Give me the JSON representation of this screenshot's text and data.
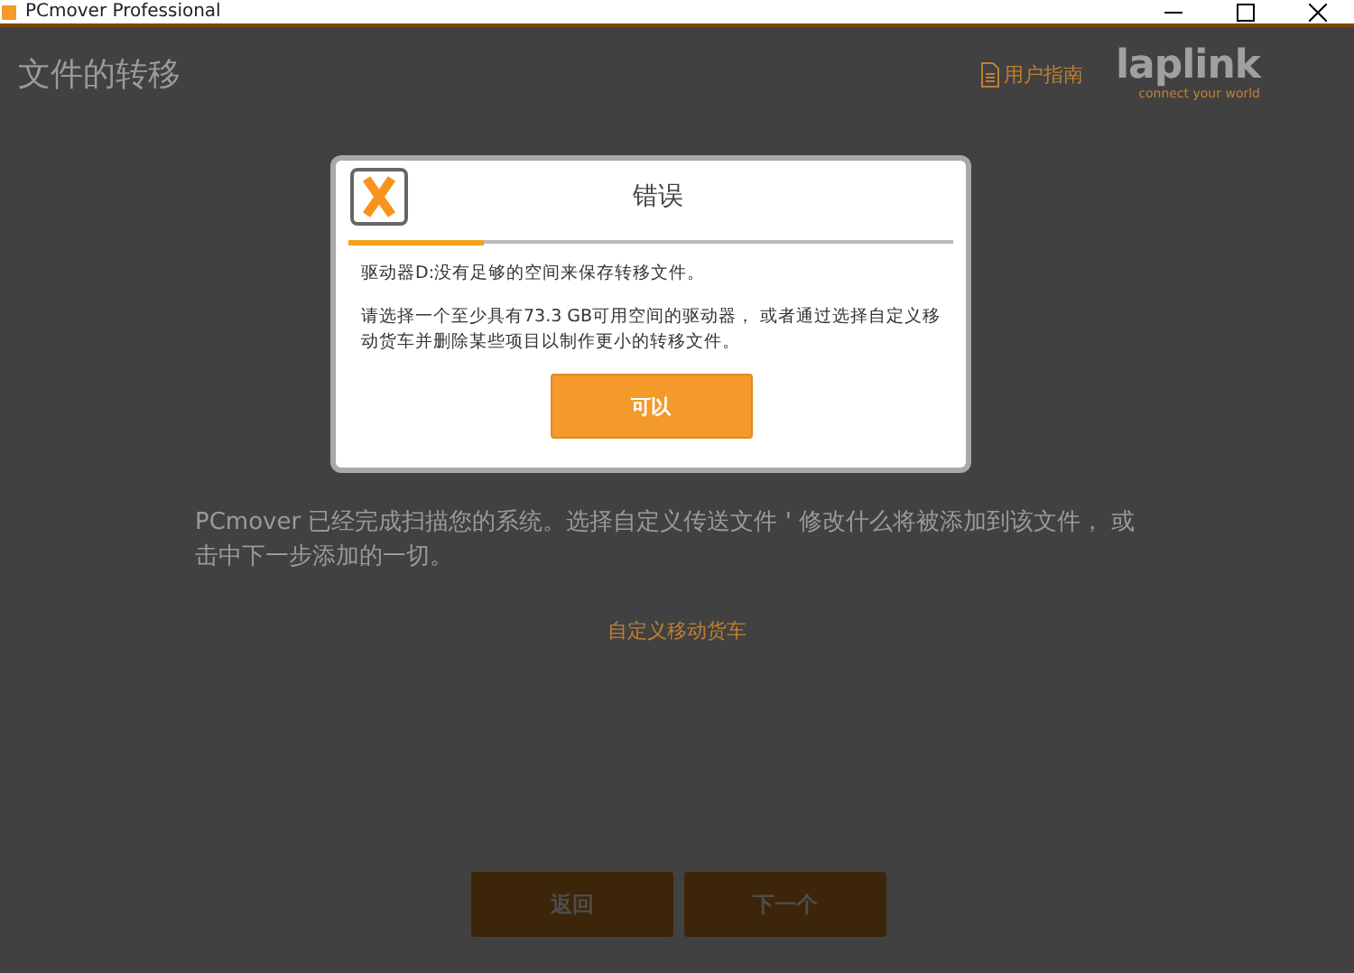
{
  "window": {
    "title": "PCmover Professional"
  },
  "page": {
    "title": "文件的转移",
    "user_guide": "用户指南",
    "logo": {
      "name": "laplink",
      "tagline": "connect your world"
    },
    "description": "PCmover 已经完成扫描您的系统。选择自定义传送文件 ' 修改什么将被添加到该文件， 或击中下一步添加的一切。",
    "link": "自定义移动货车",
    "buttons": [
      {
        "label": "返回"
      },
      {
        "label": "下一个"
      }
    ]
  },
  "dialog": {
    "title": "错误",
    "messages": [
      "驱动器D:没有足够的空间来保存转移文件。",
      "请选择一个至少具有73.3 GB可用空间的驱动器， 或者通过选择自定义移动货车并删除某些项目以制作更小的转移文件。"
    ],
    "button": "可以"
  }
}
